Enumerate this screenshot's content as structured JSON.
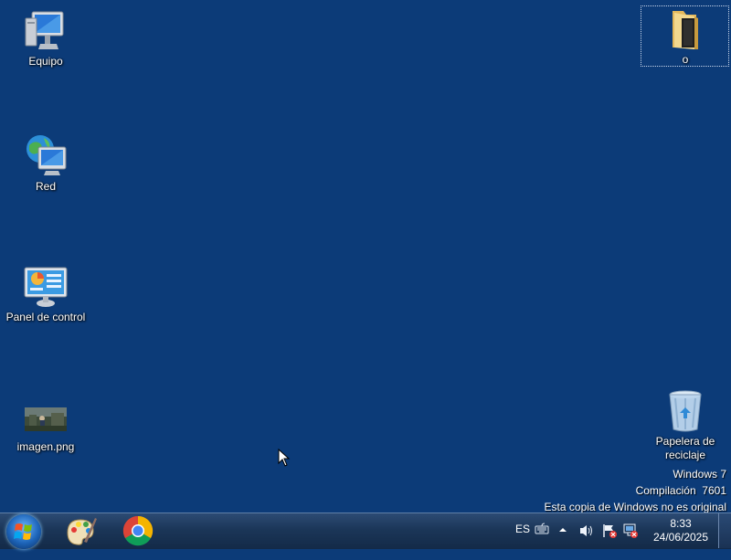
{
  "desktop": {
    "background_color": "#0c3b78",
    "icons": [
      {
        "label": "Equipo",
        "icon": "computer-icon"
      },
      {
        "label": "Red",
        "icon": "network-icon"
      },
      {
        "label": "Panel de control",
        "icon": "control-panel-icon"
      },
      {
        "label": "imagen.png",
        "icon": "image-thumbnail-icon"
      },
      {
        "label": "o",
        "icon": "folder-icon"
      },
      {
        "label": "Papelera de reciclaje",
        "icon": "recycle-bin-icon"
      }
    ],
    "watermark": {
      "line1": "Windows 7",
      "line2": "Compilación  7601",
      "line3": "Esta copia de Windows no es original"
    }
  },
  "taskbar": {
    "pinned": [
      {
        "icon": "paint-icon"
      },
      {
        "icon": "chrome-icon"
      }
    ],
    "tray": {
      "language": "ES",
      "time": "8:33",
      "date": "24/06/2025"
    }
  }
}
